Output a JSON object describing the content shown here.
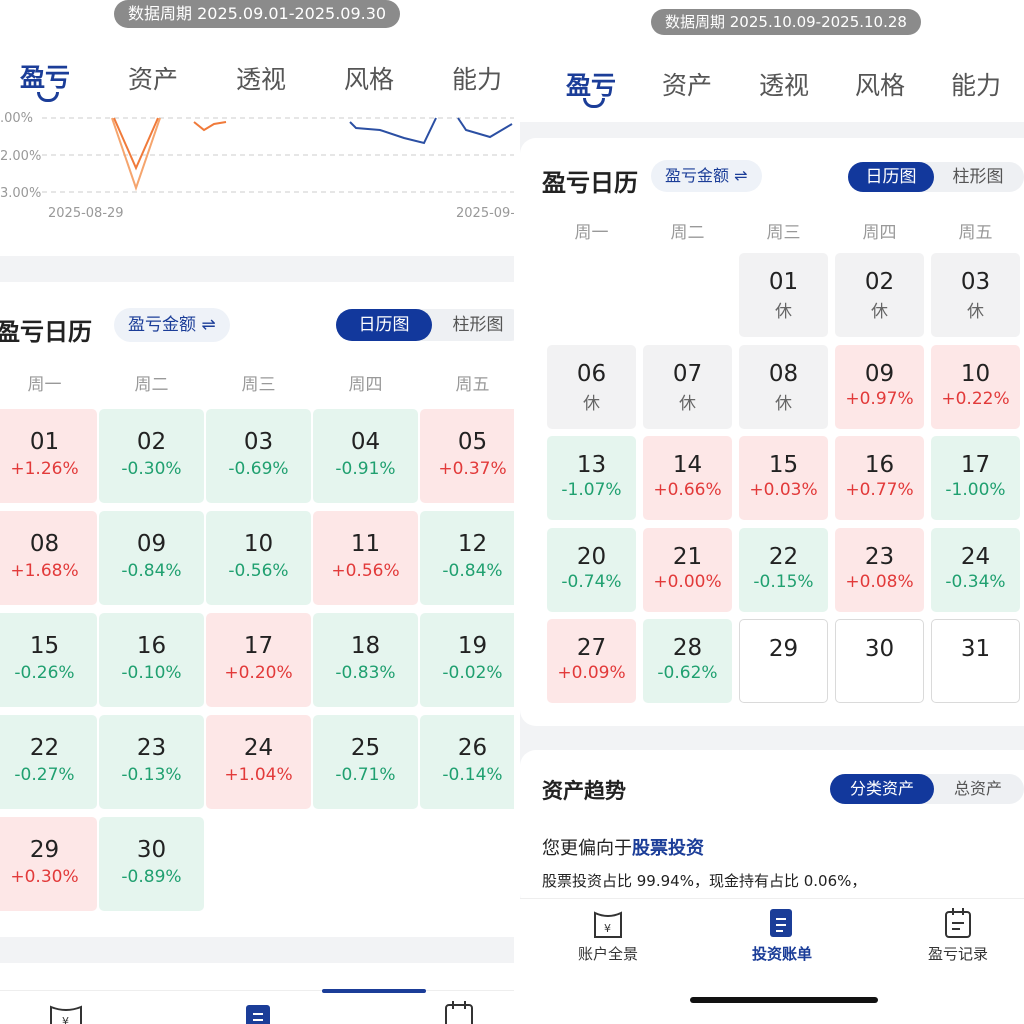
{
  "left": {
    "period": "数据周期 2025.09.01-2025.09.30",
    "tabs": [
      "盈亏",
      "资产",
      "透视",
      "风格",
      "能力"
    ],
    "chart_data": {
      "type": "line",
      "yticks": [
        "2.00%",
        "3.00%"
      ],
      "y_partial_tick": ".00%",
      "xticks": [
        "2025-08-29",
        "2025-09-"
      ],
      "series": [
        {
          "color": "#f07a3a"
        },
        {
          "color": "#f5a56e"
        },
        {
          "color": "#2b4fa3"
        }
      ]
    },
    "calendar": {
      "title": "盈亏日历",
      "amount_toggle": "盈亏金额 ⇌",
      "views": [
        "日历图",
        "柱形图"
      ],
      "weekdays": [
        "周一",
        "周二",
        "周三",
        "周四",
        "周五"
      ],
      "rows": [
        [
          {
            "d": "01",
            "v": "+1.26%",
            "t": "up"
          },
          {
            "d": "02",
            "v": "-0.30%",
            "t": "dn"
          },
          {
            "d": "03",
            "v": "-0.69%",
            "t": "dn"
          },
          {
            "d": "04",
            "v": "-0.91%",
            "t": "dn"
          },
          {
            "d": "05",
            "v": "+0.37%",
            "t": "up"
          }
        ],
        [
          {
            "d": "08",
            "v": "+1.68%",
            "t": "up"
          },
          {
            "d": "09",
            "v": "-0.84%",
            "t": "dn"
          },
          {
            "d": "10",
            "v": "-0.56%",
            "t": "dn"
          },
          {
            "d": "11",
            "v": "+0.56%",
            "t": "up"
          },
          {
            "d": "12",
            "v": "-0.84%",
            "t": "dn"
          }
        ],
        [
          {
            "d": "15",
            "v": "-0.26%",
            "t": "dn"
          },
          {
            "d": "16",
            "v": "-0.10%",
            "t": "dn"
          },
          {
            "d": "17",
            "v": "+0.20%",
            "t": "up"
          },
          {
            "d": "18",
            "v": "-0.83%",
            "t": "dn"
          },
          {
            "d": "19",
            "v": "-0.02%",
            "t": "dn"
          }
        ],
        [
          {
            "d": "22",
            "v": "-0.27%",
            "t": "dn"
          },
          {
            "d": "23",
            "v": "-0.13%",
            "t": "dn"
          },
          {
            "d": "24",
            "v": "+1.04%",
            "t": "up"
          },
          {
            "d": "25",
            "v": "-0.71%",
            "t": "dn"
          },
          {
            "d": "26",
            "v": "-0.14%",
            "t": "dn"
          }
        ],
        [
          {
            "d": "29",
            "v": "+0.30%",
            "t": "up"
          },
          {
            "d": "30",
            "v": "-0.89%",
            "t": "dn"
          }
        ]
      ]
    }
  },
  "right": {
    "period": "数据周期 2025.10.09-2025.10.28",
    "tabs": [
      "盈亏",
      "资产",
      "透视",
      "风格",
      "能力"
    ],
    "calendar": {
      "title": "盈亏日历",
      "amount_toggle": "盈亏金额 ⇌",
      "views": [
        "日历图",
        "柱形图"
      ],
      "weekdays": [
        "周一",
        "周二",
        "周三",
        "周四",
        "周五"
      ],
      "rows": [
        [
          null,
          null,
          {
            "d": "01",
            "v": "休",
            "t": "off"
          },
          {
            "d": "02",
            "v": "休",
            "t": "off"
          },
          {
            "d": "03",
            "v": "休",
            "t": "off"
          }
        ],
        [
          {
            "d": "06",
            "v": "休",
            "t": "off"
          },
          {
            "d": "07",
            "v": "休",
            "t": "off"
          },
          {
            "d": "08",
            "v": "休",
            "t": "off"
          },
          {
            "d": "09",
            "v": "+0.97%",
            "t": "up"
          },
          {
            "d": "10",
            "v": "+0.22%",
            "t": "up"
          }
        ],
        [
          {
            "d": "13",
            "v": "-1.07%",
            "t": "dn"
          },
          {
            "d": "14",
            "v": "+0.66%",
            "t": "up"
          },
          {
            "d": "15",
            "v": "+0.03%",
            "t": "up"
          },
          {
            "d": "16",
            "v": "+0.77%",
            "t": "up"
          },
          {
            "d": "17",
            "v": "-1.00%",
            "t": "dn"
          }
        ],
        [
          {
            "d": "20",
            "v": "-0.74%",
            "t": "dn"
          },
          {
            "d": "21",
            "v": "+0.00%",
            "t": "up"
          },
          {
            "d": "22",
            "v": "-0.15%",
            "t": "dn"
          },
          {
            "d": "23",
            "v": "+0.08%",
            "t": "up"
          },
          {
            "d": "24",
            "v": "-0.34%",
            "t": "dn"
          }
        ],
        [
          {
            "d": "27",
            "v": "+0.09%",
            "t": "up"
          },
          {
            "d": "28",
            "v": "-0.62%",
            "t": "dn"
          },
          {
            "d": "29",
            "v": "",
            "t": "fut"
          },
          {
            "d": "30",
            "v": "",
            "t": "fut"
          },
          {
            "d": "31",
            "v": "",
            "t": "fut"
          }
        ]
      ]
    },
    "asset_trend": {
      "title": "资产趋势",
      "views": [
        "分类资产",
        "总资产"
      ],
      "preference_prefix": "您更偏向于",
      "preference_highlight": "股票投资",
      "ratio_text": "股票投资占比 99.94%，现金持有占比 0.06%，"
    }
  },
  "bottom_nav": [
    "账户全景",
    "投资账单",
    "盈亏记录"
  ],
  "colors": {
    "brand": "#1b3d98",
    "up": "#e23a3a",
    "down": "#20a070",
    "up_bg": "#fde7e7",
    "down_bg": "#e5f5ee"
  }
}
